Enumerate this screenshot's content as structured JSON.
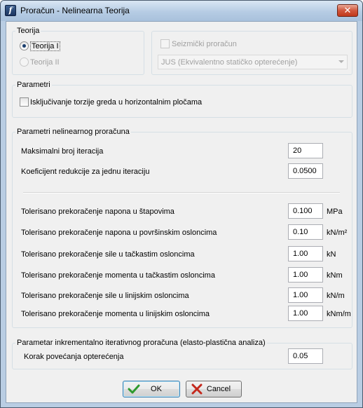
{
  "window": {
    "title": "Proračun - Nelinearna Teorija",
    "close_glyph": "✕",
    "app_icon_glyph": "f"
  },
  "teorija": {
    "legend": "Teorija",
    "option1": "Teorija I",
    "option2": "Teorija II",
    "selected": "Teorija I"
  },
  "seizmicki": {
    "checkbox_label": "Seizmički proračun",
    "combo_value": "JUS (Ekvivalentno statičko opterećenje)",
    "enabled": false
  },
  "parametri": {
    "legend": "Parametri",
    "torsion_label": "Isključivanje torzije greda u horizontalnim pločama",
    "torsion_checked": false
  },
  "nelinearni": {
    "legend": "Parametri nelinearnog proračuna",
    "rows": [
      {
        "label": "Maksimalni broj iteracija",
        "value": "20",
        "unit": ""
      },
      {
        "label": "Koeficijent redukcije za jednu iteraciju",
        "value": "0.0500",
        "unit": ""
      }
    ],
    "tolerances": [
      {
        "label": "Tolerisano prekoračenje napona u štapovima",
        "value": "0.100",
        "unit": "MPa"
      },
      {
        "label": "Tolerisano prekoračenje napona u površinskim osloncima",
        "value": "0.10",
        "unit": "kN/m²"
      },
      {
        "label": "Tolerisano prekoračenje sile u tačkastim osloncima",
        "value": "1.00",
        "unit": "kN"
      },
      {
        "label": "Tolerisano prekoračenje momenta u tačkastim osloncima",
        "value": "1.00",
        "unit": "kNm"
      },
      {
        "label": "Tolerisano prekoračenje sile u linijskim osloncima",
        "value": "1.00",
        "unit": "kN/m"
      },
      {
        "label": "Tolerisano prekoračenje momenta u linijskim osloncima",
        "value": "1.00",
        "unit": "kNm/m"
      }
    ]
  },
  "inkrementalni": {
    "legend": "Parametar inkrementalno iterativnog proračuna (elasto-plastična analiza)",
    "label": "Korak povećanja opterećenja",
    "value": "0.05"
  },
  "buttons": {
    "ok": "OK",
    "cancel": "Cancel"
  },
  "colors": {
    "ok_check": "#2e9a2e",
    "cancel_x": "#c4281c"
  }
}
